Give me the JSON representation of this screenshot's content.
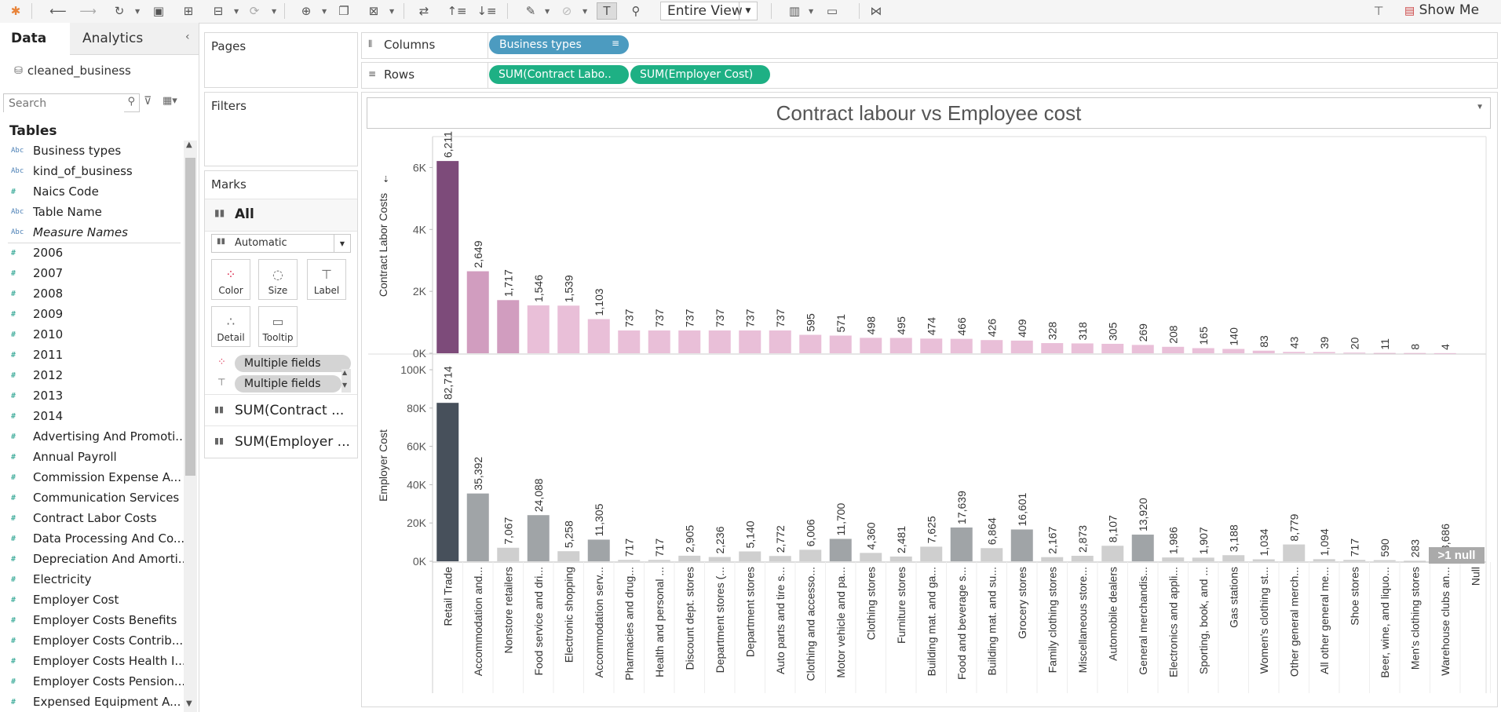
{
  "toolbar": {
    "fit_label": "Entire View",
    "show_me_label": "Show Me"
  },
  "data_pane": {
    "tab_data": "Data",
    "tab_analytics": "Analytics",
    "datasource": "cleaned_business",
    "search_placeholder": "Search",
    "tables_heading": "Tables",
    "fields": [
      {
        "type": "abc",
        "name": "Business types"
      },
      {
        "type": "abc",
        "name": "kind_of_business"
      },
      {
        "type": "num",
        "name": "Naics Code"
      },
      {
        "type": "abc",
        "name": "Table Name"
      },
      {
        "type": "abc",
        "name": "Measure Names"
      },
      {
        "type": "num",
        "name": "2006"
      },
      {
        "type": "num",
        "name": "2007"
      },
      {
        "type": "num",
        "name": "2008"
      },
      {
        "type": "num",
        "name": "2009"
      },
      {
        "type": "num",
        "name": "2010"
      },
      {
        "type": "num",
        "name": "2011"
      },
      {
        "type": "num",
        "name": "2012"
      },
      {
        "type": "num",
        "name": "2013"
      },
      {
        "type": "num",
        "name": "2014"
      },
      {
        "type": "num",
        "name": "Advertising And Promoti..."
      },
      {
        "type": "num",
        "name": "Annual Payroll"
      },
      {
        "type": "num",
        "name": "Commission Expense A..."
      },
      {
        "type": "num",
        "name": "Communication Services"
      },
      {
        "type": "num",
        "name": "Contract Labor Costs"
      },
      {
        "type": "num",
        "name": "Data Processing And Co..."
      },
      {
        "type": "num",
        "name": "Depreciation And Amorti..."
      },
      {
        "type": "num",
        "name": "Electricity"
      },
      {
        "type": "num",
        "name": "Employer Cost"
      },
      {
        "type": "num",
        "name": "Employer Costs Benefits"
      },
      {
        "type": "num",
        "name": "Employer Costs Contrib..."
      },
      {
        "type": "num",
        "name": "Employer Costs Health I..."
      },
      {
        "type": "num",
        "name": "Employer Costs Pension..."
      },
      {
        "type": "num",
        "name": "Expensed Equipment A..."
      }
    ]
  },
  "pages_label": "Pages",
  "filters_label": "Filters",
  "marks": {
    "title": "Marks",
    "all_label": "All",
    "mark_type": "Automatic",
    "buttons": [
      "Color",
      "Size",
      "Label",
      "Detail",
      "Tooltip"
    ],
    "pills": [
      "Multiple fields",
      "Multiple fields"
    ],
    "measures": [
      "SUM(Contract ...",
      "SUM(Employer ..."
    ]
  },
  "shelves": {
    "columns_label": "Columns",
    "columns_pill": "Business types",
    "rows_label": "Rows",
    "rows_pills": [
      "SUM(Contract Labo..",
      "SUM(Employer Cost)"
    ]
  },
  "null_indicator": ">1 null",
  "colors": {
    "accent_green": "#1eb084",
    "accent_blue": "#4c9bc0",
    "top_dark": "#7d4b7a",
    "top_mid": "#d19dbf",
    "top_light": "#e9bfd8",
    "bottom_dark": "#47505b",
    "bottom_mid": "#a0a4a7",
    "bottom_light": "#cfcfcf"
  },
  "chart_data": {
    "type": "bar",
    "title": "Contract labour vs Employee cost",
    "categories": [
      "Retail Trade",
      "Accommodation and...",
      "Nonstore retailers",
      "Food service and dri...",
      "Electronic shopping",
      "Accommodation serv...",
      "Pharmacies and drug...",
      "Health and personal ...",
      "Discount dept. stores",
      "Department stores (...",
      "Department stores",
      "Auto parts and tire s...",
      "Clothing and accesso...",
      "Motor vehicle and pa...",
      "Clothing stores",
      "Furniture stores",
      "Building mat. and ga...",
      "Food and beverage s...",
      "Building mat. and su...",
      "Grocery stores",
      "Family clothing stores",
      "Miscellaneous store...",
      "Automobile dealers",
      "General merchandis...",
      "Electronics and appli...",
      "Sporting, book, and ...",
      "Gas stations",
      "Women's clothing st...",
      "Other general merch...",
      "All other general me...",
      "Shoe stores",
      "Beer, wine, and liquo...",
      "Men's clothing stores",
      "Warehouse clubs an...",
      "Null"
    ],
    "series": [
      {
        "name": "Contract Labor Costs",
        "ylim": [
          0,
          7000
        ],
        "ticks": [
          "0K",
          "2K",
          "4K",
          "6K"
        ],
        "values": [
          6211,
          2649,
          1717,
          1546,
          1539,
          1103,
          737,
          737,
          737,
          737,
          737,
          737,
          595,
          571,
          498,
          495,
          474,
          466,
          426,
          409,
          328,
          318,
          305,
          269,
          208,
          165,
          140,
          83,
          43,
          39,
          20,
          11,
          8,
          4,
          null
        ],
        "labels": [
          "6,211",
          "2,649",
          "1,717",
          "1,546",
          "1,539",
          "1,103",
          "737",
          "737",
          "737",
          "737",
          "737",
          "737",
          "595",
          "571",
          "498",
          "495",
          "474",
          "466",
          "426",
          "409",
          "328",
          "318",
          "305",
          "269",
          "208",
          "165",
          "140",
          "83",
          "43",
          "39",
          "20",
          "11",
          "8",
          "4",
          ""
        ]
      },
      {
        "name": "Employer Cost",
        "ylim": [
          0,
          100000
        ],
        "ticks": [
          "0K",
          "20K",
          "40K",
          "60K",
          "80K",
          "100K"
        ],
        "values": [
          82714,
          35392,
          7067,
          24088,
          5258,
          11305,
          717,
          717,
          2905,
          2236,
          5140,
          2772,
          6006,
          11700,
          4360,
          2481,
          7625,
          17639,
          6864,
          16601,
          2167,
          2873,
          8107,
          13920,
          1986,
          1907,
          3188,
          1034,
          8779,
          1094,
          717,
          590,
          283,
          3686,
          null
        ],
        "labels": [
          "82,714",
          "35,392",
          "7,067",
          "24,088",
          "5,258",
          "11,305",
          "717",
          "717",
          "2,905",
          "2,236",
          "5,140",
          "2,772",
          "6,006",
          "11,700",
          "4,360",
          "2,481",
          "7,625",
          "17,639",
          "6,864",
          "16,601",
          "2,167",
          "2,873",
          "8,107",
          "13,920",
          "1,986",
          "1,907",
          "3,188",
          "1,034",
          "8,779",
          "1,094",
          "717",
          "590",
          "283",
          "3,686",
          ""
        ]
      }
    ]
  }
}
